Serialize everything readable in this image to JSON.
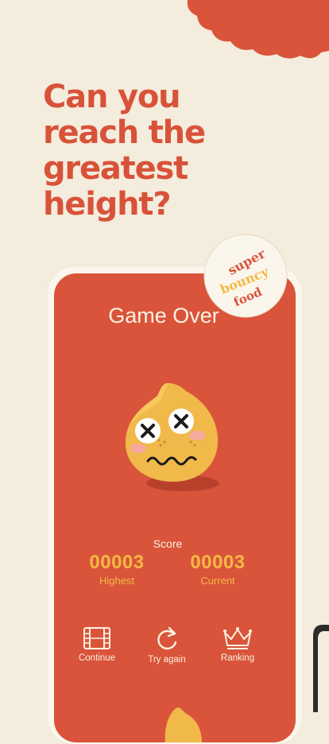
{
  "headline": {
    "line1": "Can you",
    "line2": "reach the",
    "line3": "greatest",
    "line4": "height?"
  },
  "sticker": {
    "word1": "super",
    "word2": "bouncy",
    "word3": "food"
  },
  "game": {
    "title": "Game Over",
    "score_title": "Score",
    "highest_value": "00003",
    "highest_label": "Highest",
    "current_value": "00003",
    "current_label": "Current"
  },
  "actions": {
    "continue_label": "Continue",
    "try_again_label": "Try again",
    "ranking_label": "Ranking"
  },
  "colors": {
    "background": "#f4ecdc",
    "accent_red": "#d9543a",
    "accent_yellow": "#f4b944",
    "cream": "#fbf1e2"
  },
  "icons": [
    "film-icon",
    "retry-icon",
    "crown-icon",
    "dizzy-mascot"
  ]
}
